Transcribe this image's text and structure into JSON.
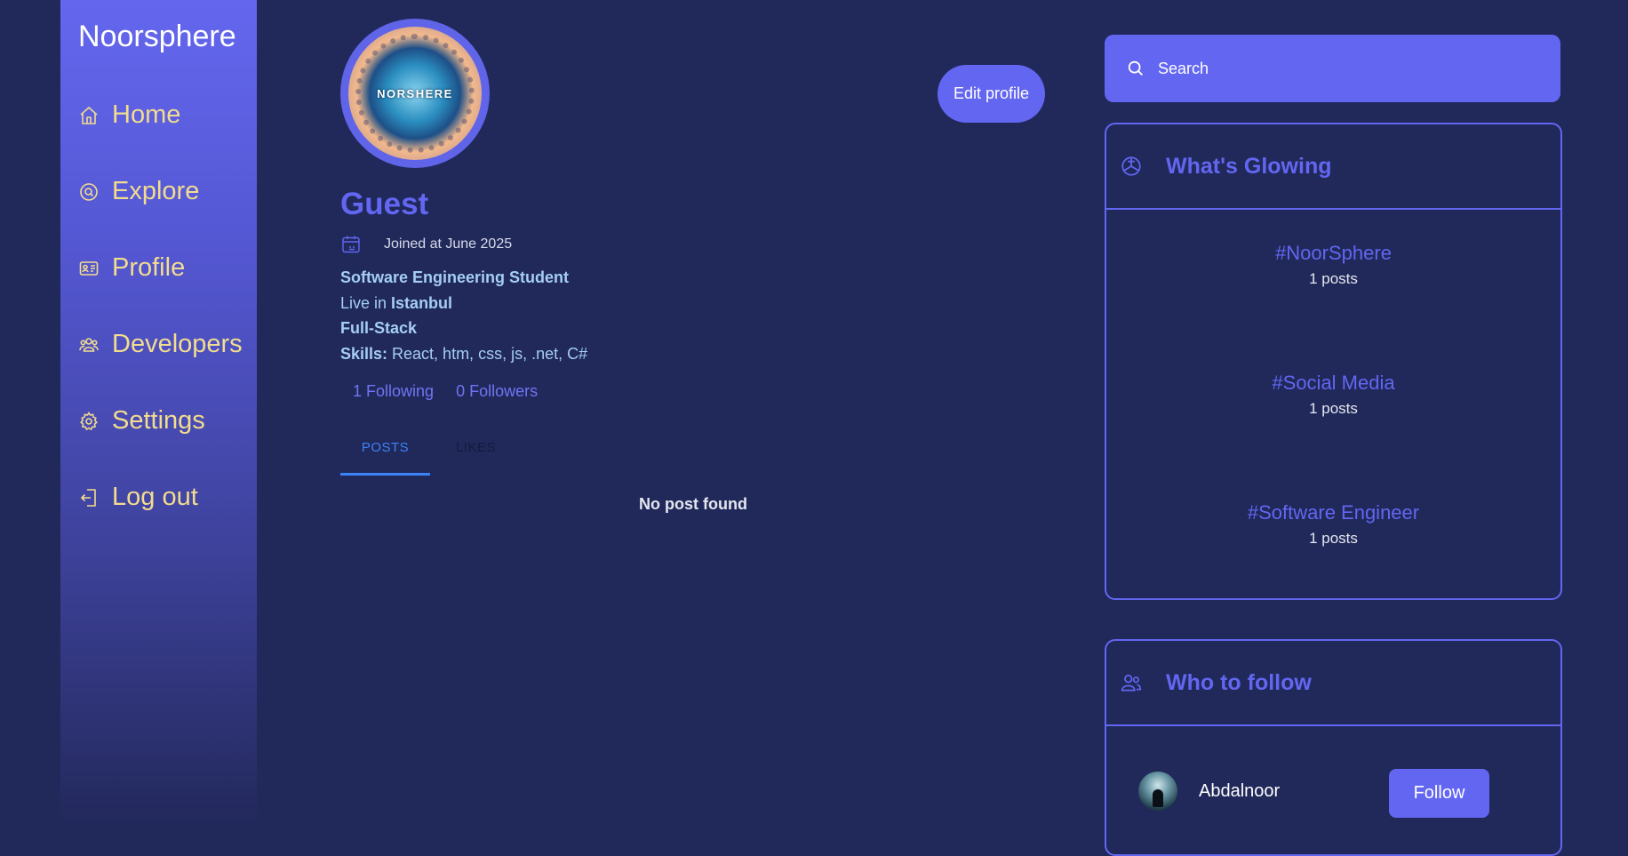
{
  "sidebar": {
    "brand": "Noorsphere",
    "items": [
      {
        "label": "Home",
        "icon": "home-icon"
      },
      {
        "label": "Explore",
        "icon": "explore-icon"
      },
      {
        "label": "Profile",
        "icon": "id-card-icon"
      },
      {
        "label": "Developers",
        "icon": "users-group-icon"
      },
      {
        "label": "Settings",
        "icon": "gear-icon"
      },
      {
        "label": "Log out",
        "icon": "logout-icon"
      }
    ]
  },
  "profile": {
    "avatar_text": "NORSHERE",
    "edit_label": "Edit profile",
    "name": "Guest",
    "joined": "Joined at June 2025",
    "title": "Software Engineering Student",
    "live_prefix": "Live in ",
    "city": "Istanbul",
    "role": "Full-Stack",
    "skills_label": "Skills:",
    "skills": " React, htm, css, js, .net, C#",
    "following": "1 Following",
    "followers": "0 Followers",
    "tabs": {
      "posts": "POSTS",
      "likes": "LIKES"
    },
    "empty": "No post found"
  },
  "search": {
    "placeholder": "Search"
  },
  "glowing": {
    "title": "What's Glowing",
    "trends": [
      {
        "tag": "#NoorSphere",
        "count": "1 posts"
      },
      {
        "tag": "#Social Media",
        "count": "1 posts"
      },
      {
        "tag": "#Software Engineer",
        "count": "1 posts"
      }
    ]
  },
  "who_to_follow": {
    "title": "Who to follow",
    "users": [
      {
        "name": "Abdalnoor",
        "button": "Follow"
      }
    ]
  },
  "colors": {
    "background": "#20295a",
    "accent": "#6366f1",
    "nav_text": "#f2dc8e",
    "info_text": "#a5cdf5",
    "tab_active": "#3b82f6"
  }
}
